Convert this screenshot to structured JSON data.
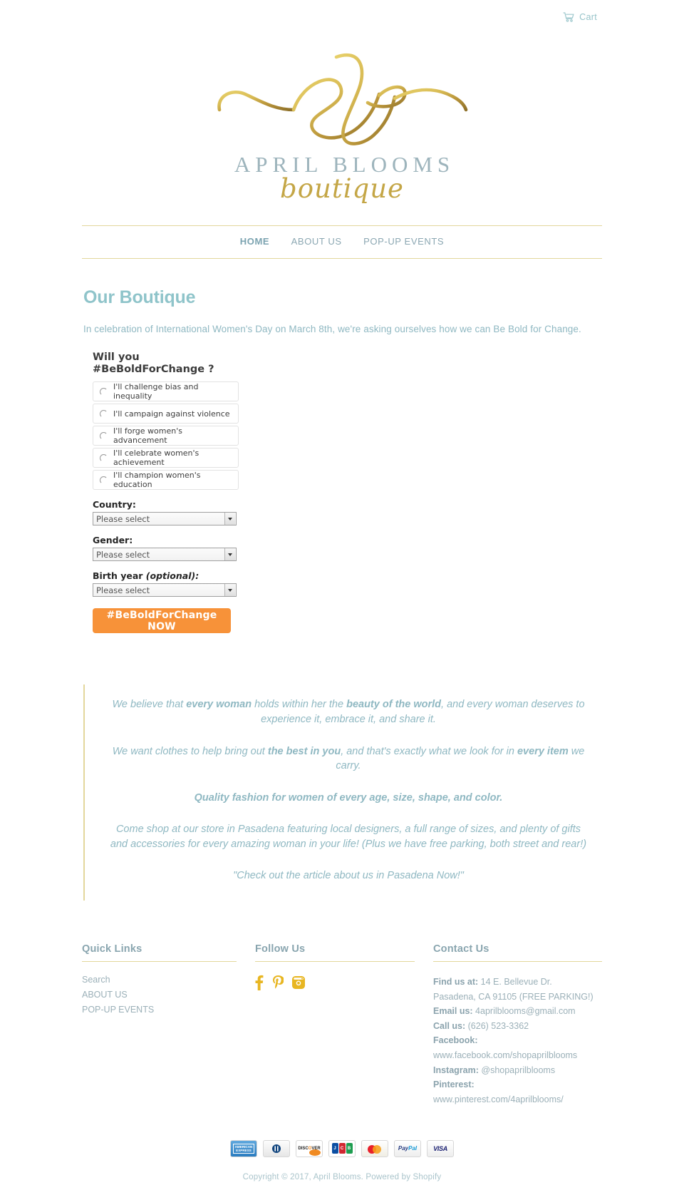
{
  "header": {
    "cart_label": "Cart",
    "cart_icon": "shopping-cart-icon",
    "logo": {
      "monogram": "ab-script-monogram",
      "name": "APRIL BLOOMS",
      "subtitle": "boutique"
    }
  },
  "nav": {
    "items": [
      {
        "label": "HOME",
        "active": true
      },
      {
        "label": "ABOUT US",
        "active": false
      },
      {
        "label": "POP-UP EVENTS",
        "active": false
      }
    ]
  },
  "main": {
    "title": "Our Boutique",
    "intro": "In celebration of International Women's Day on March 8th, we're asking ourselves how we can Be Bold for Change.",
    "poll": {
      "question_line1": "Will you",
      "question_line2": "#BeBoldForChange ?",
      "options": [
        "I'll challenge bias and inequality",
        "I'll campaign against violence",
        "I'll forge women's advancement",
        "I'll celebrate women's achievement",
        "I'll champion women's education"
      ],
      "fields": [
        {
          "label": "Country:",
          "optional_note": "",
          "value": "Please select"
        },
        {
          "label": "Gender:",
          "optional_note": "",
          "value": "Please select"
        },
        {
          "label": "Birth year ",
          "optional_note": "(optional):",
          "value": "Please select"
        }
      ],
      "submit_label": "#BeBoldForChange NOW",
      "submit_color": "#f79239"
    },
    "quote": {
      "p1_a": "We believe that ",
      "p1_b": "every woman",
      "p1_c": " holds within her the ",
      "p1_d": "beauty of the world",
      "p1_e": ", and every woman deserves to experience it, embrace it, and share it.",
      "p2_a": "We want clothes to help bring out ",
      "p2_b": "the best in you",
      "p2_c": ", and that's exactly what we look for in ",
      "p2_d": "every item",
      "p2_e": " we carry.",
      "p3": "Quality fashion for women of every age, size, shape, and color.",
      "p4": "Come shop at our store in Pasadena featuring local designers, a full range of sizes, and plenty of gifts and accessories for every amazing woman in your life! (Plus  we have free parking, both street and rear!)",
      "p5": "\"Check out the article about us in Pasadena Now!\""
    }
  },
  "footer": {
    "quick_links": {
      "title": "Quick Links",
      "items": [
        "Search",
        "ABOUT US",
        "POP-UP EVENTS"
      ]
    },
    "follow": {
      "title": "Follow Us",
      "icons": [
        "facebook-icon",
        "pinterest-icon",
        "instagram-icon"
      ],
      "icon_color": "#e8b622"
    },
    "contact": {
      "title": "Contact Us",
      "lines": [
        {
          "label": "Find us at:",
          "value": " 14 E. Bellevue Dr."
        },
        {
          "label": "",
          "value": "Pasadena, CA 91105 (FREE PARKING!)"
        },
        {
          "label": "Email us:",
          "value": " 4aprilblooms@gmail.com"
        },
        {
          "label": "Call us:",
          "value": " (626) 523-3362"
        },
        {
          "label": "Facebook:",
          "value": ""
        },
        {
          "label": "",
          "value": "www.facebook.com/shopaprilblooms"
        },
        {
          "label": "Instagram:",
          "value": " @shopaprilblooms"
        },
        {
          "label": "Pinterest:",
          "value": " www.pinterest.com/4aprilblooms/"
        }
      ]
    },
    "payments": [
      "AMERICAN EXPRESS",
      "Diners Club",
      "DISCOVER",
      "JCB",
      "Mastercard",
      "PayPal",
      "VISA"
    ],
    "copyright": "Copyright © 2017, April Blooms. Powered by Shopify"
  },
  "colors": {
    "accent_teal": "#8fc4ca",
    "accent_gold": "#e3d79c",
    "text_blue_gray": "#9bb0b8",
    "button_orange": "#f79239"
  }
}
